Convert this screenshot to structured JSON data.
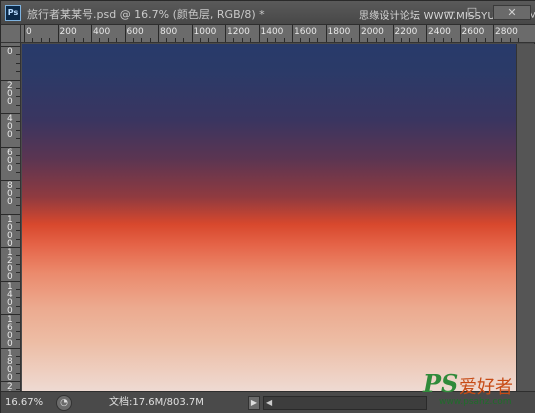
{
  "window": {
    "title": "旅行者某某号.psd @ 16.7% (颜色层, RGB/8) *",
    "watermark": "思缘设计论坛 WWW.MISSYUAN.COM",
    "app_icon_label": "Ps"
  },
  "title_buttons": {
    "minimize": "—",
    "maximize": "□",
    "close": "✕"
  },
  "ruler_top": {
    "labels": [
      "0",
      "200",
      "400",
      "600",
      "800",
      "1000",
      "1200",
      "1400",
      "1600",
      "1800",
      "2000",
      "2200",
      "2400",
      "2600",
      "2800"
    ]
  },
  "ruler_left": {
    "groups": [
      [
        "0"
      ],
      [
        "2",
        "0",
        "0"
      ],
      [
        "4",
        "0",
        "0"
      ],
      [
        "6",
        "0",
        "0"
      ],
      [
        "8",
        "0",
        "0"
      ],
      [
        "1",
        "0",
        "0",
        "0"
      ],
      [
        "1",
        "2",
        "0",
        "0"
      ],
      [
        "1",
        "4",
        "0",
        "0"
      ],
      [
        "1",
        "6",
        "0",
        "0"
      ],
      [
        "1",
        "8",
        "0",
        "0"
      ],
      [
        "2",
        "0",
        "0",
        "0"
      ]
    ]
  },
  "canvas": {
    "gradient_colors": [
      "#283a6a",
      "#3a3560",
      "#8f3a40",
      "#d8482d",
      "#eb8a6c",
      "#edbda5",
      "#eedad2"
    ]
  },
  "status": {
    "zoom": "16.67%",
    "doc_info": "文档:17.6M/803.7M",
    "menu_arrow": "▶",
    "scroll_left": "◀"
  },
  "site_logo": {
    "ps": "PS",
    "chinese": "爱好者",
    "url": "www.psahz.com"
  }
}
